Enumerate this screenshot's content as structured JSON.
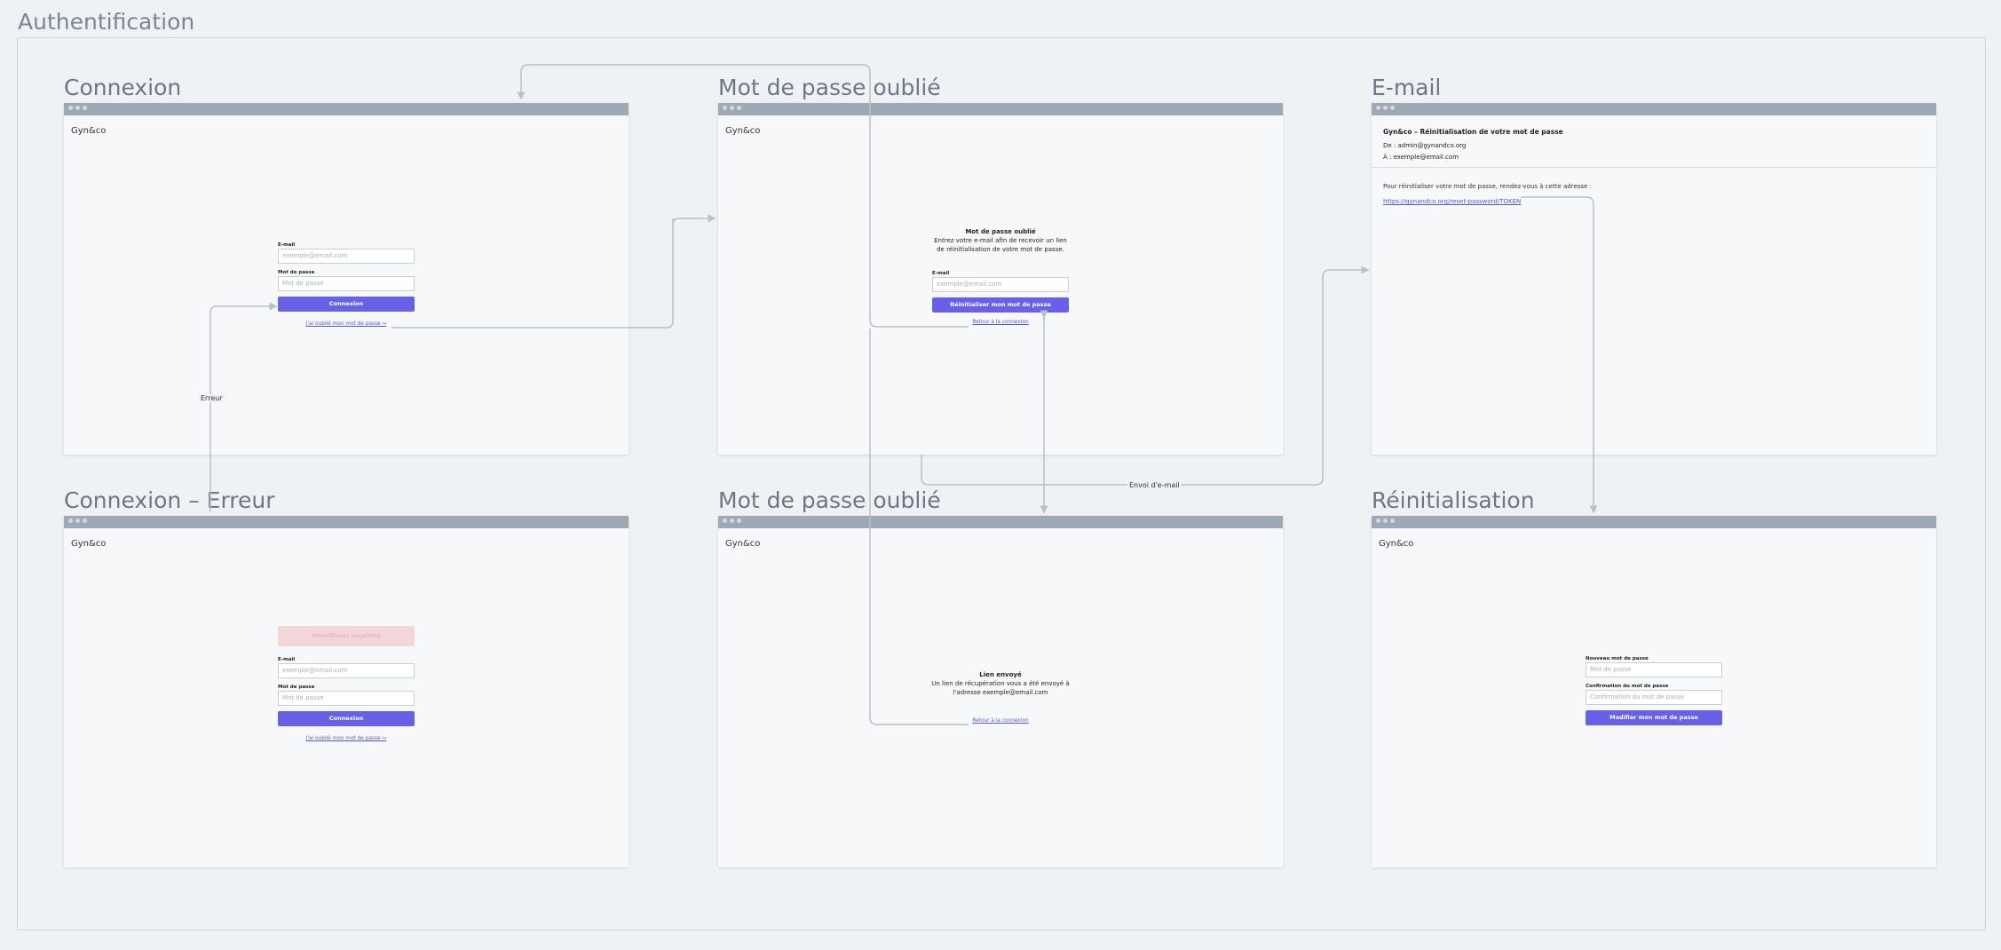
{
  "board": {
    "title": "Authentification"
  },
  "brand": "Gyn&co",
  "screens": {
    "connexion": {
      "title": "Connexion",
      "email_label": "E-mail",
      "email_placeholder": "exemple@email.com",
      "password_label": "Mot de passe",
      "password_placeholder": "Mot de passe",
      "submit": "Connexion",
      "forgot_link": "J'ai oublié mon mot de passe ↪"
    },
    "forgot": {
      "title": "Mot de passe oublié",
      "heading": "Mot de passe oublié",
      "desc_line1": "Entrez votre e-mail afin de recevoir un lien",
      "desc_line2": "de réinitialisation de votre mot de passe.",
      "email_label": "E-mail",
      "email_placeholder": "exemple@email.com",
      "submit": "Réinitialiser mon mot de passe",
      "back_link": "Retour à la connexion"
    },
    "email": {
      "title": "E-mail",
      "subject": "Gyn&co – Réinitialisation de votre mot de passe",
      "from": "De : admin@gynandco.org",
      "to": "À : exemple@email.com",
      "body": "Pour réinitialiser votre mot de passe, rendez-vous à cette adresse :",
      "link": "https://gynandco.org/reset-password/TOKEN"
    },
    "connexion_error": {
      "title": "Connexion – Erreur",
      "error_banner": "Identifiants invalides",
      "email_label": "E-mail",
      "email_placeholder": "exemple@email.com",
      "password_label": "Mot de passe",
      "password_placeholder": "Mot de passe",
      "submit": "Connexion",
      "forgot_link": "J'ai oublié mon mot de passe ↪"
    },
    "sent": {
      "title": "Mot de passe oublié",
      "heading": "Lien envoyé",
      "desc_line1": "Un lien de récupération vous a été envoyé à",
      "desc_line2": "l'adresse exemple@email.com",
      "back_link": "Retour à la connexion"
    },
    "reset": {
      "title": "Réinitialisation",
      "new_label": "Nouveau mot de passe",
      "new_placeholder": "Mot de passe",
      "confirm_label": "Confirmation du mot de passe",
      "confirm_placeholder": "Confirmation du mot de passe",
      "submit": "Modifier mon mot de passe"
    }
  },
  "edges": {
    "error_label": "Erreur",
    "send_email_label": "Envoi d'e-mail"
  },
  "colors": {
    "accent": "#6960e8",
    "link": "#5b55d6",
    "titlebar": "#9ea9b6",
    "error_bg": "#f2d6da",
    "connector": "#b8c0c9"
  }
}
